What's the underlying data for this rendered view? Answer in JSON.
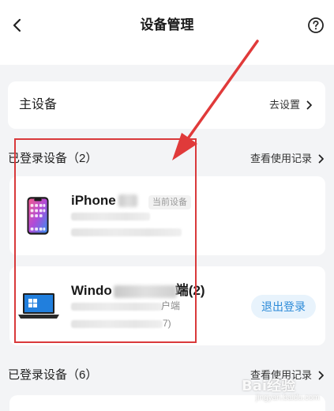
{
  "header": {
    "title": "设备管理",
    "back_icon": "chevron-left-icon",
    "help_icon": "question-circle-icon"
  },
  "primary_device": {
    "label": "主设备",
    "action_label": "去设置"
  },
  "logged_in_section": {
    "title": "已登录设备（2）",
    "link_label": "查看使用记录"
  },
  "devices": [
    {
      "name": "iPhone",
      "badge": "当前设备",
      "icon": "iphone-device-icon"
    },
    {
      "name_prefix": "Windo",
      "name_suffix": "端(2)",
      "detail_fragment_1": "户端",
      "detail_fragment_2": "7)",
      "action_label": "退出登录",
      "icon": "laptop-device-icon"
    }
  ],
  "other_section": {
    "title": "已登录设备（6）",
    "link_label": "查看使用记录"
  },
  "annotation": {
    "highlight_color": "#d9393b"
  },
  "watermark": {
    "main": "Bai经验",
    "sub": "jingyan.baidu.com"
  }
}
